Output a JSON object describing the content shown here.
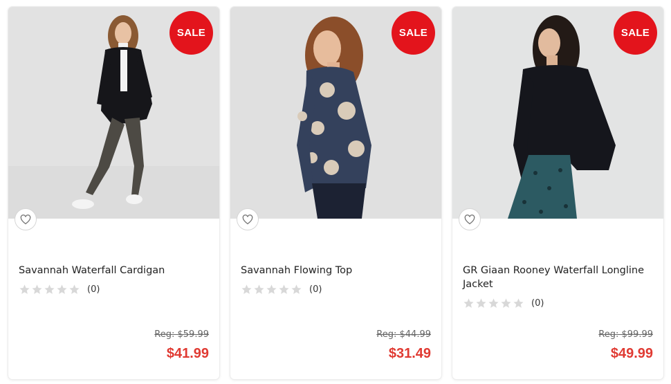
{
  "products": [
    {
      "name": "Savannah Waterfall Cardigan",
      "badge": "SALE",
      "rating_stars": 0,
      "review_count": "(0)",
      "reg_price": "Reg: $59.99",
      "sale_price": "$41.99"
    },
    {
      "name": "Savannah Flowing Top",
      "badge": "SALE",
      "rating_stars": 0,
      "review_count": "(0)",
      "reg_price": "Reg: $44.99",
      "sale_price": "$31.49"
    },
    {
      "name": "GR Giaan Rooney Waterfall Longline Jacket",
      "badge": "SALE",
      "rating_stars": 0,
      "review_count": "(0)",
      "reg_price": "Reg: $99.99",
      "sale_price": "$49.99"
    }
  ],
  "colors": {
    "badge": "#e3141c",
    "sale_price": "#e03a32",
    "star_empty": "#d8d8d8"
  },
  "icons": {
    "wishlist": "heart-outline-icon",
    "rating": "star-icon"
  }
}
